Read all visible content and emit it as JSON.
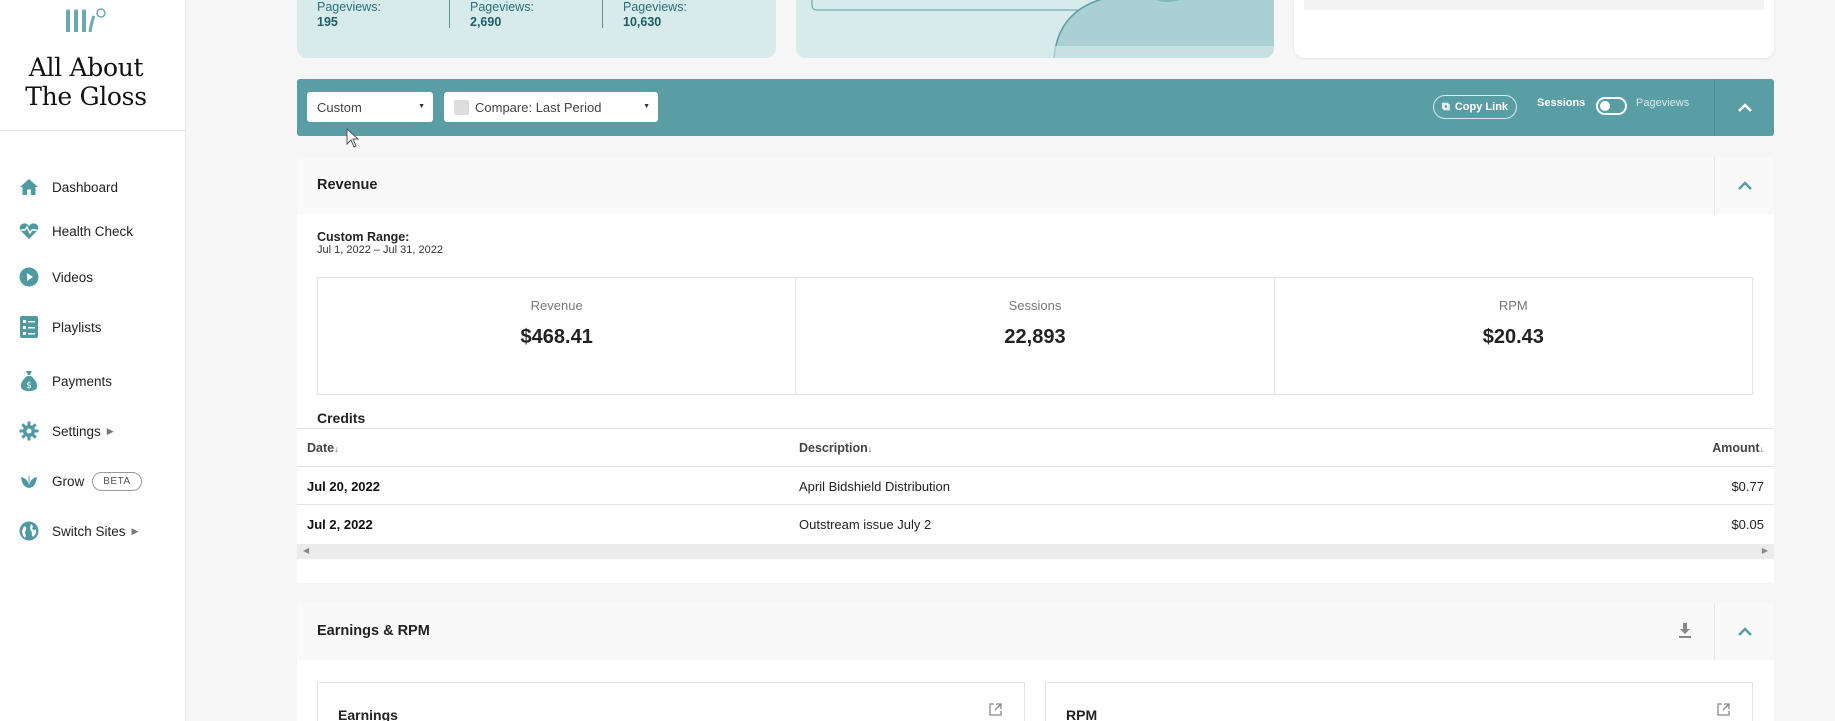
{
  "sidebar": {
    "brand_line1": "All About",
    "brand_line2": "The Gloss",
    "items": [
      {
        "label": "Dashboard"
      },
      {
        "label": "Health Check"
      },
      {
        "label": "Videos"
      },
      {
        "label": "Playlists"
      },
      {
        "label": "Payments"
      },
      {
        "label": "Settings"
      },
      {
        "label": "Grow",
        "badge": "BETA"
      },
      {
        "label": "Switch Sites"
      }
    ]
  },
  "top_stats": [
    {
      "label": "Pageviews:",
      "value": "195"
    },
    {
      "label": "Pageviews:",
      "value": "2,690"
    },
    {
      "label": "Pageviews:",
      "value": "10,630"
    }
  ],
  "toolbar": {
    "range_select": "Custom",
    "compare_select": "Compare: Last Period",
    "copy_link": "Copy Link",
    "toggle_left": "Sessions",
    "toggle_right": "Pageviews"
  },
  "revenue": {
    "title": "Revenue",
    "range_label": "Custom Range:",
    "range_value": "Jul 1, 2022 – Jul 31, 2022",
    "metrics": [
      {
        "label": "Revenue",
        "value": "$468.41"
      },
      {
        "label": "Sessions",
        "value": "22,893"
      },
      {
        "label": "RPM",
        "value": "$20.43"
      }
    ],
    "credits_title": "Credits",
    "columns": [
      "Date",
      "Description",
      "Amount"
    ],
    "rows": [
      {
        "date": "Jul 20, 2022",
        "description": "April Bidshield Distribution",
        "amount": "$0.77"
      },
      {
        "date": "Jul 2, 2022",
        "description": "Outstream issue July 2",
        "amount": "$0.05"
      }
    ]
  },
  "earnings": {
    "title": "Earnings & RPM",
    "cards": [
      {
        "title": "Earnings"
      },
      {
        "title": "RPM"
      }
    ]
  },
  "colors": {
    "toolbar": "#5a9ea5",
    "stat_card": "#d8ebeb",
    "accent_text": "#2a6f79"
  }
}
